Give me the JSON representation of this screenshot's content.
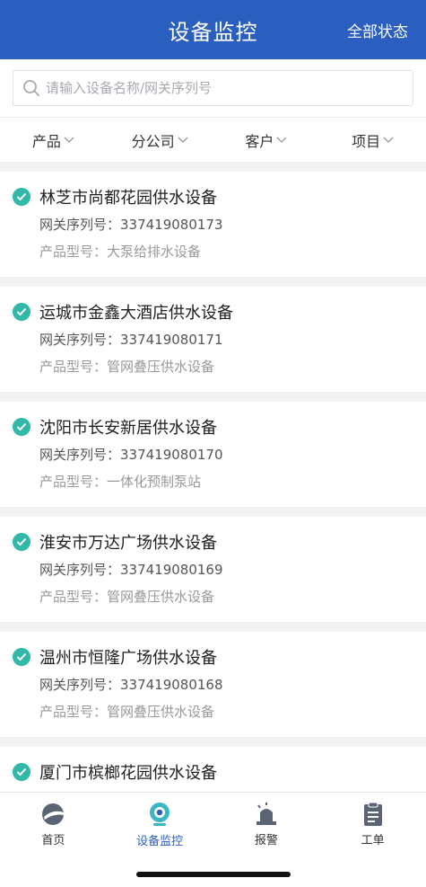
{
  "header": {
    "title": "设备监控",
    "right_action": "全部状态"
  },
  "search": {
    "placeholder": "请输入设备名称/网关序列号",
    "value": ""
  },
  "filters": [
    {
      "label": "产品"
    },
    {
      "label": "分公司"
    },
    {
      "label": "客户"
    },
    {
      "label": "项目"
    }
  ],
  "devices": [
    {
      "name": "林芝市尚都花园供水设备",
      "serial": "网关序列号：337419080173",
      "model": "产品型号：大泵给排水设备"
    },
    {
      "name": "运城市金鑫大酒店供水设备",
      "serial": "网关序列号：337419080171",
      "model": "产品型号：管网叠压供水设备"
    },
    {
      "name": "沈阳市长安新居供水设备",
      "serial": "网关序列号：337419080170",
      "model": "产品型号：一体化预制泵站"
    },
    {
      "name": "淮安市万达广场供水设备",
      "serial": "网关序列号：337419080169",
      "model": "产品型号：管网叠压供水设备"
    },
    {
      "name": "温州市恒隆广场供水设备",
      "serial": "网关序列号：337419080168",
      "model": "产品型号：管网叠压供水设备"
    },
    {
      "name": "厦门市槟榔花园供水设备",
      "serial": "",
      "model": ""
    }
  ],
  "tabbar": {
    "items": [
      {
        "label": "首页",
        "icon": "home-icon",
        "active": false
      },
      {
        "label": "设备监控",
        "icon": "monitor-icon",
        "active": true
      },
      {
        "label": "报警",
        "icon": "alarm-icon",
        "active": false
      },
      {
        "label": "工单",
        "icon": "work-order-icon",
        "active": false
      }
    ]
  },
  "colors": {
    "header_bg": "#2b5fbf",
    "status_ok": "#32b8a6",
    "active_tab": "#2b5fbf"
  }
}
